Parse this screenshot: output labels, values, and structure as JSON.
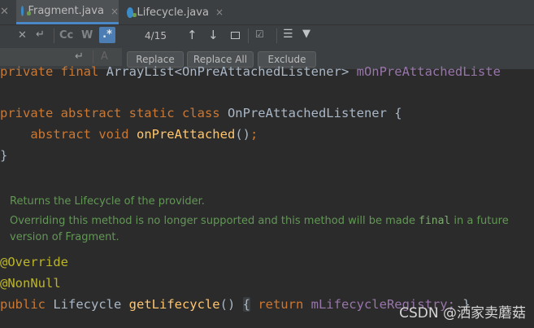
{
  "tabs": [
    {
      "label": "Fragment.java",
      "close": "×"
    },
    {
      "label": "Lifecycle.java",
      "close": "×"
    }
  ],
  "find": {
    "counter": "4/15",
    "toggle_cc": "Cc",
    "toggle_w": "W",
    "toggle_regex": ".*",
    "replace_label": "Replace",
    "replace_all_label": "Replace All",
    "exclude_label": "Exclude"
  },
  "code": {
    "line0_kw": "private final ",
    "line0_type": "ArrayList<OnPreAttachedListener> ",
    "line0_field": "mOnPreAttachedListe",
    "line1_kw": "private abstract static class ",
    "line1_name": "OnPreAttachedListener ",
    "line1_brace": "{",
    "line2_kw": "abstract void ",
    "line2_fn": "onPreAttached",
    "line2_paren": "()",
    "line2_semi": ";",
    "line3": "}",
    "doc1": "Returns the Lifecycle of the provider.",
    "doc2a": "Overriding this method is no longer supported and this method will be made ",
    "doc2_mono": "final",
    "doc2b": " in a future",
    "doc3": "version of Fragment.",
    "ann1": "@Override",
    "ann2": "@NonNull",
    "last_kw": "public ",
    "last_type": "Lifecycle ",
    "last_fn": "getLifecycle",
    "last_paren": "() ",
    "last_brace": "{",
    "last_return": " return ",
    "last_field": "mLifecycleRegistry;",
    "last_close": " }"
  },
  "watermark": "CSDN @洒家卖蘑菇"
}
